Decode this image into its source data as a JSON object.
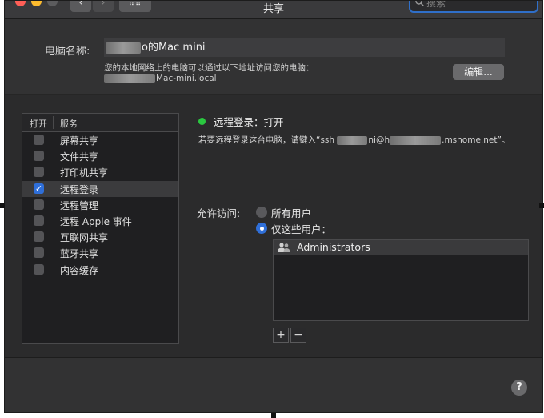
{
  "window": {
    "title": "共享"
  },
  "toolbar": {
    "back_glyph": "‹",
    "forward_glyph": "›",
    "grid_glyph": "⠿⠿",
    "search_placeholder": "搜索",
    "search_icon": "magnifier-icon"
  },
  "computer": {
    "name_label": "电脑名称:",
    "name_value": "Mac mini",
    "name_value_visible_suffix": "o的Mac mini",
    "address_note": "您的本地网络上的电脑可以通过以下地址访问您的电脑：",
    "address_host_suffix": "Mac-mini.local",
    "edit_button": "编辑..."
  },
  "services": {
    "header_open": "打开",
    "header_service": "服务",
    "items": [
      {
        "label": "屏幕共享",
        "checked": false
      },
      {
        "label": "文件共享",
        "checked": false
      },
      {
        "label": "打印机共享",
        "checked": false
      },
      {
        "label": "远程登录",
        "checked": true
      },
      {
        "label": "远程管理",
        "checked": false
      },
      {
        "label": "远程 Apple 事件",
        "checked": false
      },
      {
        "label": "互联网共享",
        "checked": false
      },
      {
        "label": "蓝牙共享",
        "checked": false
      },
      {
        "label": "内容缓存",
        "checked": false
      }
    ],
    "selected_index": 3
  },
  "detail": {
    "status": "远程登录：打开",
    "status_color": "#2ac840",
    "ssh_hint_prefix": "若要远程登录这台电脑，请键入“ssh ",
    "ssh_hint_mid": "ni@h",
    "ssh_hint_suffix": ".mshome.net”。",
    "allow_label": "允许访问:",
    "radio_all": "所有用户",
    "radio_only": "仅这些用户：",
    "selected_radio": "only",
    "users": [
      "Administrators"
    ],
    "add_glyph": "+",
    "remove_glyph": "−"
  },
  "help_glyph": "?",
  "colors": {
    "accent": "#2f6fd9",
    "window_bg": "#323233"
  }
}
